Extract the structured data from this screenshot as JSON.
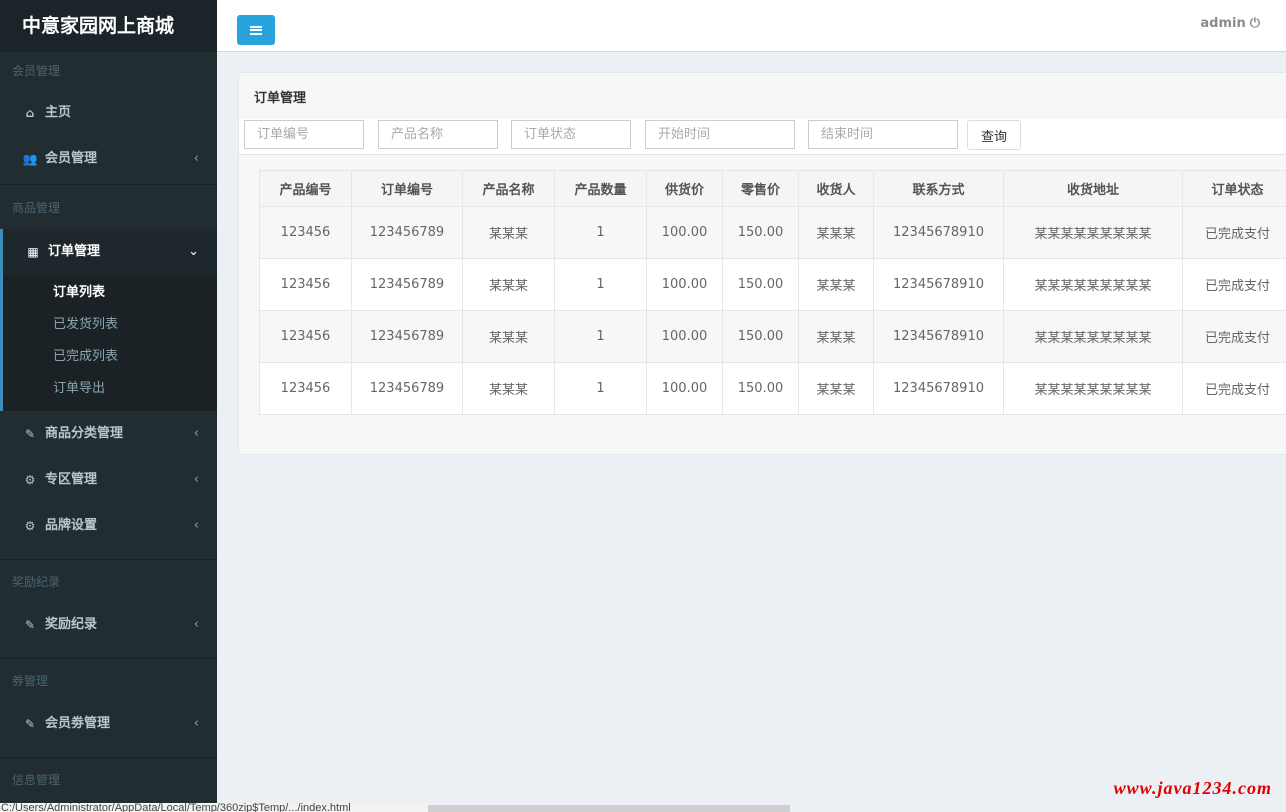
{
  "brand": "中意家园网上商城",
  "sidebar": {
    "sections": [
      {
        "header": "会员管理"
      },
      {
        "header": "商品管理"
      },
      {
        "header": "奖励纪录"
      },
      {
        "header": "券管理"
      },
      {
        "header": "信息管理"
      }
    ],
    "items": {
      "home": {
        "label": "主页",
        "icon": "home-icon"
      },
      "members": {
        "label": "会员管理",
        "icon": "users-icon"
      },
      "orders": {
        "label": "订单管理",
        "icon": "calendar-icon"
      },
      "categories": {
        "label": "商品分类管理",
        "icon": "edit-icon"
      },
      "zones": {
        "label": "专区管理",
        "icon": "cogs-icon"
      },
      "brands": {
        "label": "品牌设置",
        "icon": "cogs-icon"
      },
      "rewards": {
        "label": "奖励纪录",
        "icon": "edit-icon"
      },
      "vouchers": {
        "label": "会员劵管理",
        "icon": "edit-icon"
      }
    },
    "order_subitems": [
      "订单列表",
      "已发货列表",
      "已完成列表",
      "订单导出"
    ]
  },
  "header": {
    "user": "admin"
  },
  "main": {
    "title": "订单管理",
    "filters": {
      "order_no_placeholder": "订单编号",
      "product_name_placeholder": "产品名称",
      "order_status_placeholder": "订单状态",
      "start_time_placeholder": "开始时间",
      "end_time_placeholder": "结束时间",
      "query_label": "查询"
    },
    "table": {
      "columns": [
        "产品编号",
        "订单编号",
        "产品名称",
        "产品数量",
        "供货价",
        "零售价",
        "收货人",
        "联系方式",
        "收货地址",
        "订单状态"
      ],
      "rows": [
        [
          "123456",
          "123456789",
          "某某某",
          "1",
          "100.00",
          "150.00",
          "某某某",
          "12345678910",
          "某某某某某某某某某",
          "已完成支付"
        ],
        [
          "123456",
          "123456789",
          "某某某",
          "1",
          "100.00",
          "150.00",
          "某某某",
          "12345678910",
          "某某某某某某某某某",
          "已完成支付"
        ],
        [
          "123456",
          "123456789",
          "某某某",
          "1",
          "100.00",
          "150.00",
          "某某某",
          "12345678910",
          "某某某某某某某某某",
          "已完成支付"
        ],
        [
          "123456",
          "123456789",
          "某某某",
          "1",
          "100.00",
          "150.00",
          "某某某",
          "12345678910",
          "某某某某某某某某某",
          "已完成支付"
        ]
      ]
    }
  },
  "statusbar": "C:/Users/Administrator/AppData/Local/Temp/360zip$Temp/.../index.html",
  "watermark": "www.java1234.com",
  "colors": {
    "sidebar_bg": "#222d32",
    "toggle_btn": "#29a3dd",
    "active_accent": "#3c8dbc",
    "watermark": "#e00000"
  }
}
